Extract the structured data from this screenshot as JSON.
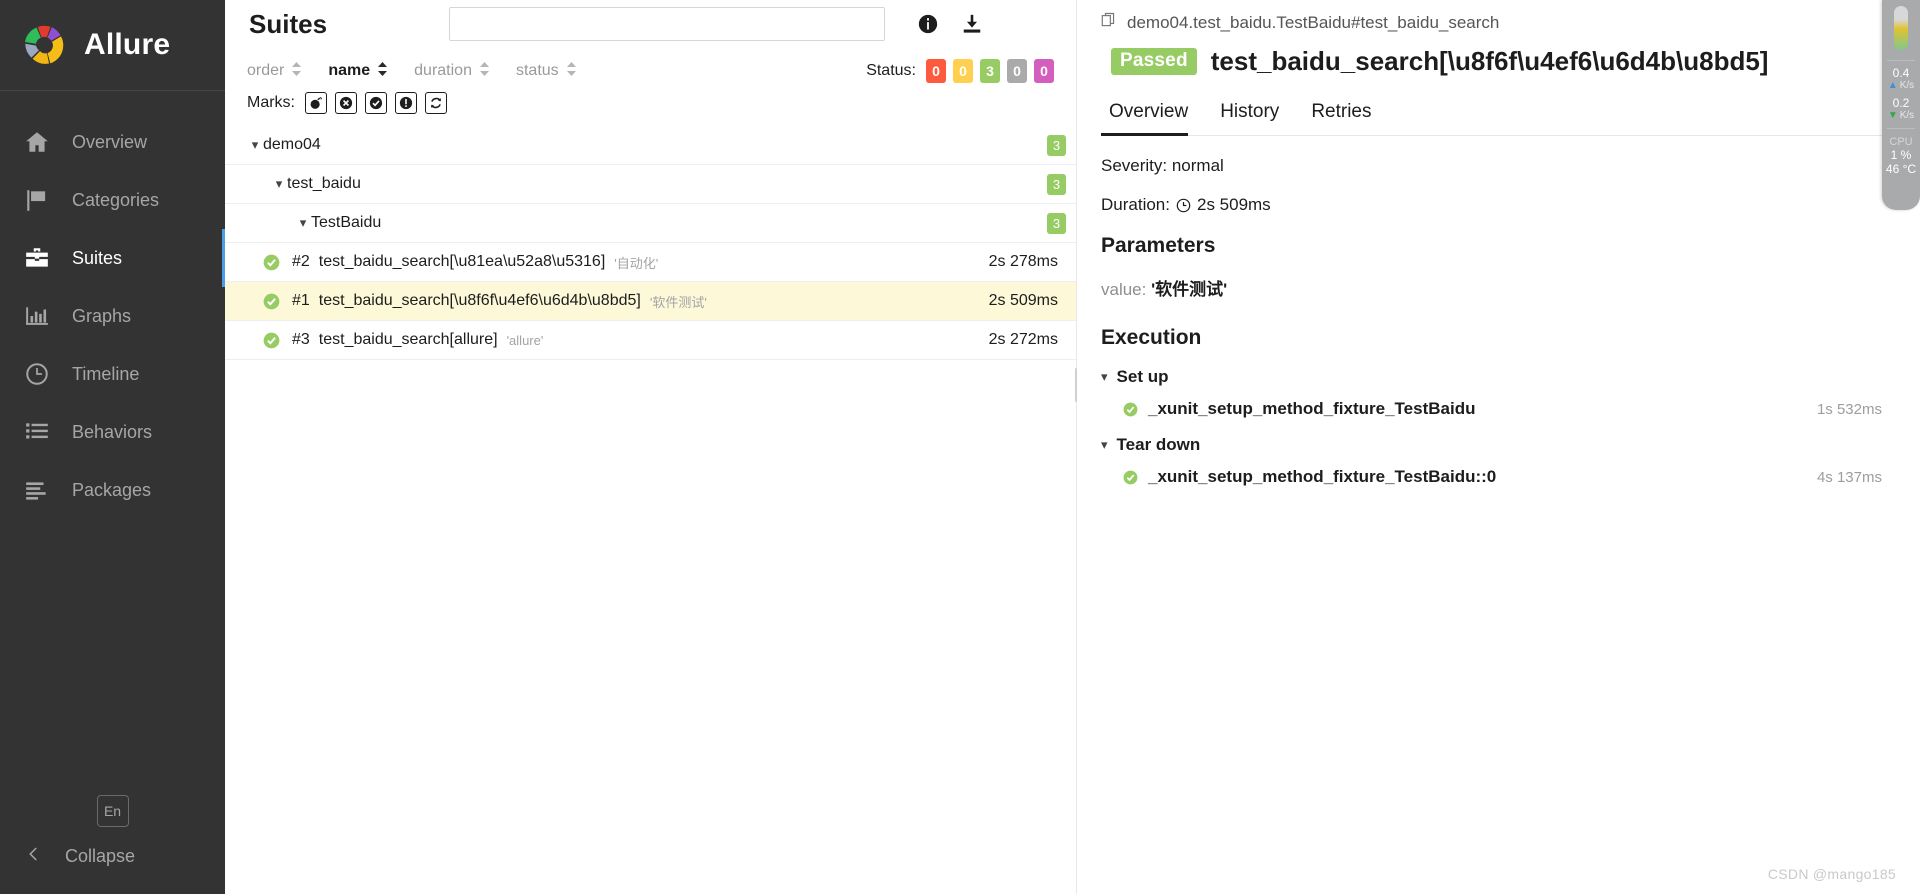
{
  "sidebar": {
    "brand": "Allure",
    "items": [
      {
        "label": "Overview",
        "icon": "home-icon",
        "active": false
      },
      {
        "label": "Categories",
        "icon": "flag-icon",
        "active": false
      },
      {
        "label": "Suites",
        "icon": "briefcase-icon",
        "active": true
      },
      {
        "label": "Graphs",
        "icon": "bar-chart-icon",
        "active": false
      },
      {
        "label": "Timeline",
        "icon": "clock-icon",
        "active": false
      },
      {
        "label": "Behaviors",
        "icon": "list-icon",
        "active": false
      },
      {
        "label": "Packages",
        "icon": "packages-icon",
        "active": false
      }
    ],
    "language": "En",
    "collapse": "Collapse"
  },
  "suites": {
    "title": "Suites",
    "search_value": "",
    "search_placeholder": "",
    "sort": [
      {
        "label": "order",
        "active": false
      },
      {
        "label": "name",
        "active": true
      },
      {
        "label": "duration",
        "active": false
      },
      {
        "label": "status",
        "active": false
      }
    ],
    "status_label": "Status:",
    "status_badges": [
      {
        "count": "0",
        "color": "#fd5a3e"
      },
      {
        "count": "0",
        "color": "#ffd050"
      },
      {
        "count": "3",
        "color": "#97cc64"
      },
      {
        "count": "0",
        "color": "#aaaaaa"
      },
      {
        "count": "0",
        "color": "#d35ebe"
      }
    ],
    "marks_label": "Marks:",
    "marks": [
      {
        "icon": "bomb-icon"
      },
      {
        "icon": "times-circle-icon"
      },
      {
        "icon": "check-circle-icon"
      },
      {
        "icon": "exclamation-circle-icon"
      },
      {
        "icon": "refresh-icon"
      }
    ],
    "tree": [
      {
        "label": "demo04",
        "indent": 0,
        "count": "3"
      },
      {
        "label": "test_baidu",
        "indent": 1,
        "count": "3"
      },
      {
        "label": "TestBaidu",
        "indent": 2,
        "count": "3"
      }
    ],
    "tests": [
      {
        "num": "#2",
        "name": "test_baidu_search[\\u81ea\\u52a8\\u5316]",
        "tag": "'自动化'",
        "duration": "2s 278ms",
        "status": "passed",
        "selected": false
      },
      {
        "num": "#1",
        "name": "test_baidu_search[\\u8f6f\\u4ef6\\u6d4b\\u8bd5]",
        "tag": "'软件测试'",
        "duration": "2s 509ms",
        "status": "passed",
        "selected": true
      },
      {
        "num": "#3",
        "name": "test_baidu_search[allure]",
        "tag": "'allure'",
        "duration": "2s 272ms",
        "status": "passed",
        "selected": false
      }
    ]
  },
  "detail": {
    "breadcrumb": "demo04.test_baidu.TestBaidu#test_baidu_search",
    "status_label": "Passed",
    "title": "test_baidu_search[\\u8f6f\\u4ef6\\u6d4b\\u8bd5]",
    "tabs": [
      {
        "label": "Overview",
        "active": true
      },
      {
        "label": "History",
        "active": false
      },
      {
        "label": "Retries",
        "active": false
      }
    ],
    "severity": "Severity: normal",
    "duration_label": "Duration:",
    "duration_value": "2s 509ms",
    "parameters_heading": "Parameters",
    "parameter_key": "value:",
    "parameter_value": "'软件测试'",
    "execution_heading": "Execution",
    "setup_group": "Set up",
    "setup_items": [
      {
        "label": "_xunit_setup_method_fixture_TestBaidu",
        "duration": "1s 532ms"
      }
    ],
    "teardown_group": "Tear down",
    "teardown_items": [
      {
        "label": "_xunit_setup_method_fixture_TestBaidu::0",
        "duration": "4s 137ms"
      }
    ]
  },
  "sysmon": {
    "upload_value": "0.4",
    "upload_unit": "K/s",
    "download_value": "0.2",
    "download_unit": "K/s",
    "cpu_label": "CPU",
    "cpu_usage": "1 %",
    "cpu_temp": "46 °C"
  },
  "watermark": "CSDN @mango185"
}
